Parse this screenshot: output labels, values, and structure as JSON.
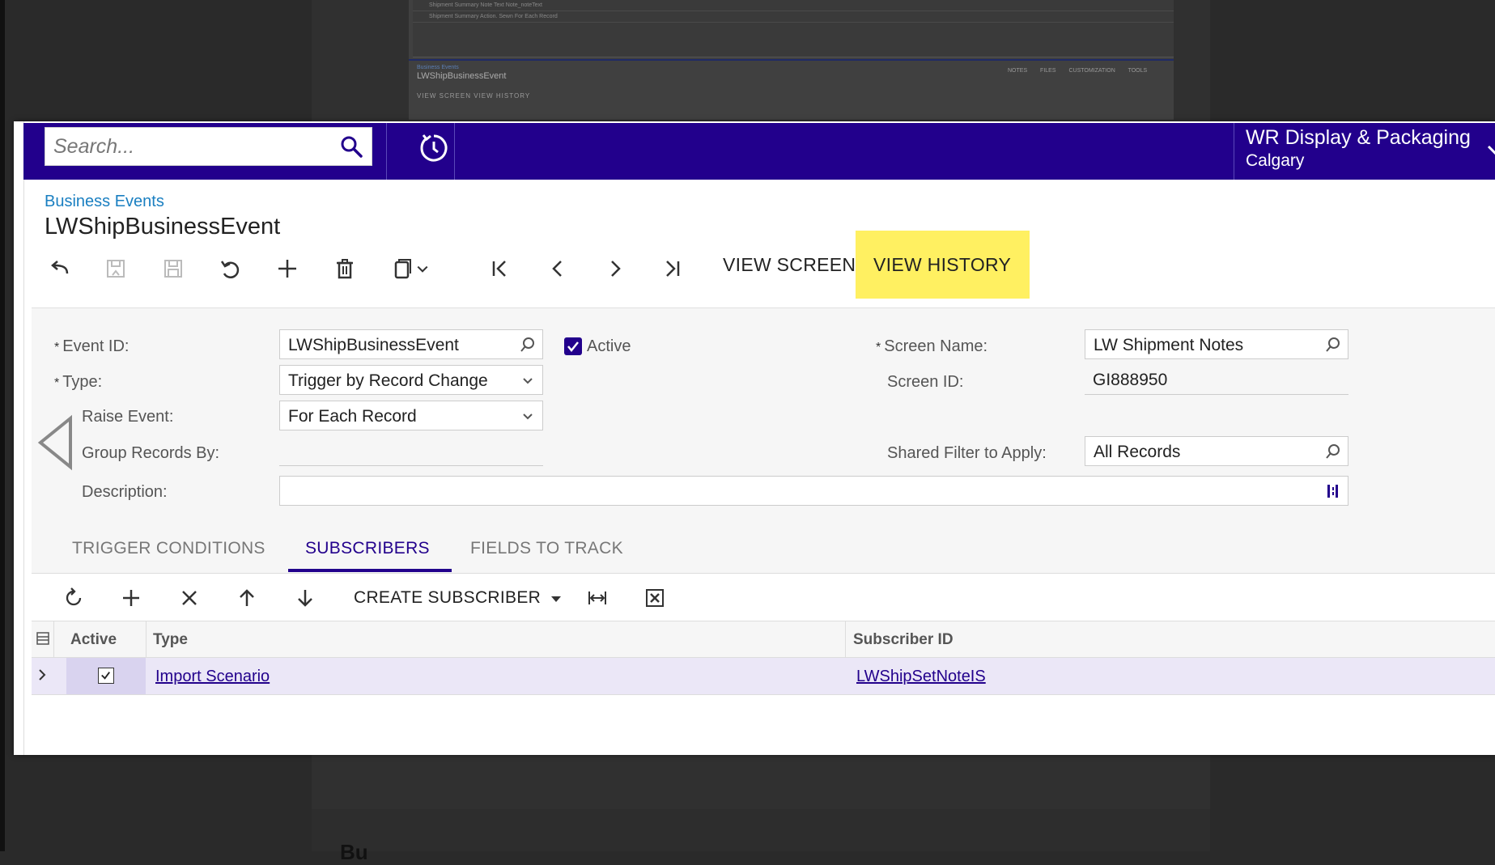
{
  "background": {
    "bg_title": "LWShipBusinessEvent",
    "bg_breadcrumb": "Business Events",
    "bg_toolbar": "VIEW SCREEN   VIEW HISTORY",
    "bg_tools": "NOTES FILES CUSTOMIZATION TOOLS",
    "bg_rows": [
      "Shipment Summary        Note Text                         Note_noteText",
      "Shipment Summary        Action. Sewn                                                For Each Record"
    ],
    "bg_bottom": "Bu"
  },
  "header": {
    "search_placeholder": "Search...",
    "company_name": "WR Display & Packaging",
    "company_branch": "Calgary"
  },
  "page": {
    "breadcrumb": "Business Events",
    "title": "LWShipBusinessEvent"
  },
  "toolbar": {
    "view_screen": "VIEW SCREEN",
    "view_history": "VIEW HISTORY"
  },
  "form": {
    "required_mark": "*",
    "event_id_label": "Event ID:",
    "event_id_value": "LWShipBusinessEvent",
    "active_label": "Active",
    "active_checked": true,
    "type_label": "Type:",
    "type_value": "Trigger by Record Change",
    "raise_event_label": "Raise Event:",
    "raise_event_value": "For Each Record",
    "group_records_label": "Group Records By:",
    "group_records_value": "",
    "description_label": "Description:",
    "description_value": "",
    "screen_name_label": "Screen Name:",
    "screen_name_value": "LW Shipment Notes",
    "screen_id_label": "Screen ID:",
    "screen_id_value": "GI888950",
    "shared_filter_label": "Shared Filter to Apply:",
    "shared_filter_value": "All Records"
  },
  "tabs": [
    {
      "label": "TRIGGER CONDITIONS",
      "active": false
    },
    {
      "label": "SUBSCRIBERS",
      "active": true
    },
    {
      "label": "FIELDS TO TRACK",
      "active": false
    }
  ],
  "grid": {
    "create_subscriber": "CREATE SUBSCRIBER",
    "columns": [
      "Active",
      "Type",
      "Subscriber ID"
    ],
    "rows": [
      {
        "active": true,
        "type": "Import Scenario",
        "subscriber_id": "LWShipSetNoteIS"
      }
    ]
  },
  "colors": {
    "brand": "#22008c",
    "highlight": "#fff061",
    "link": "#1a7fc1"
  }
}
